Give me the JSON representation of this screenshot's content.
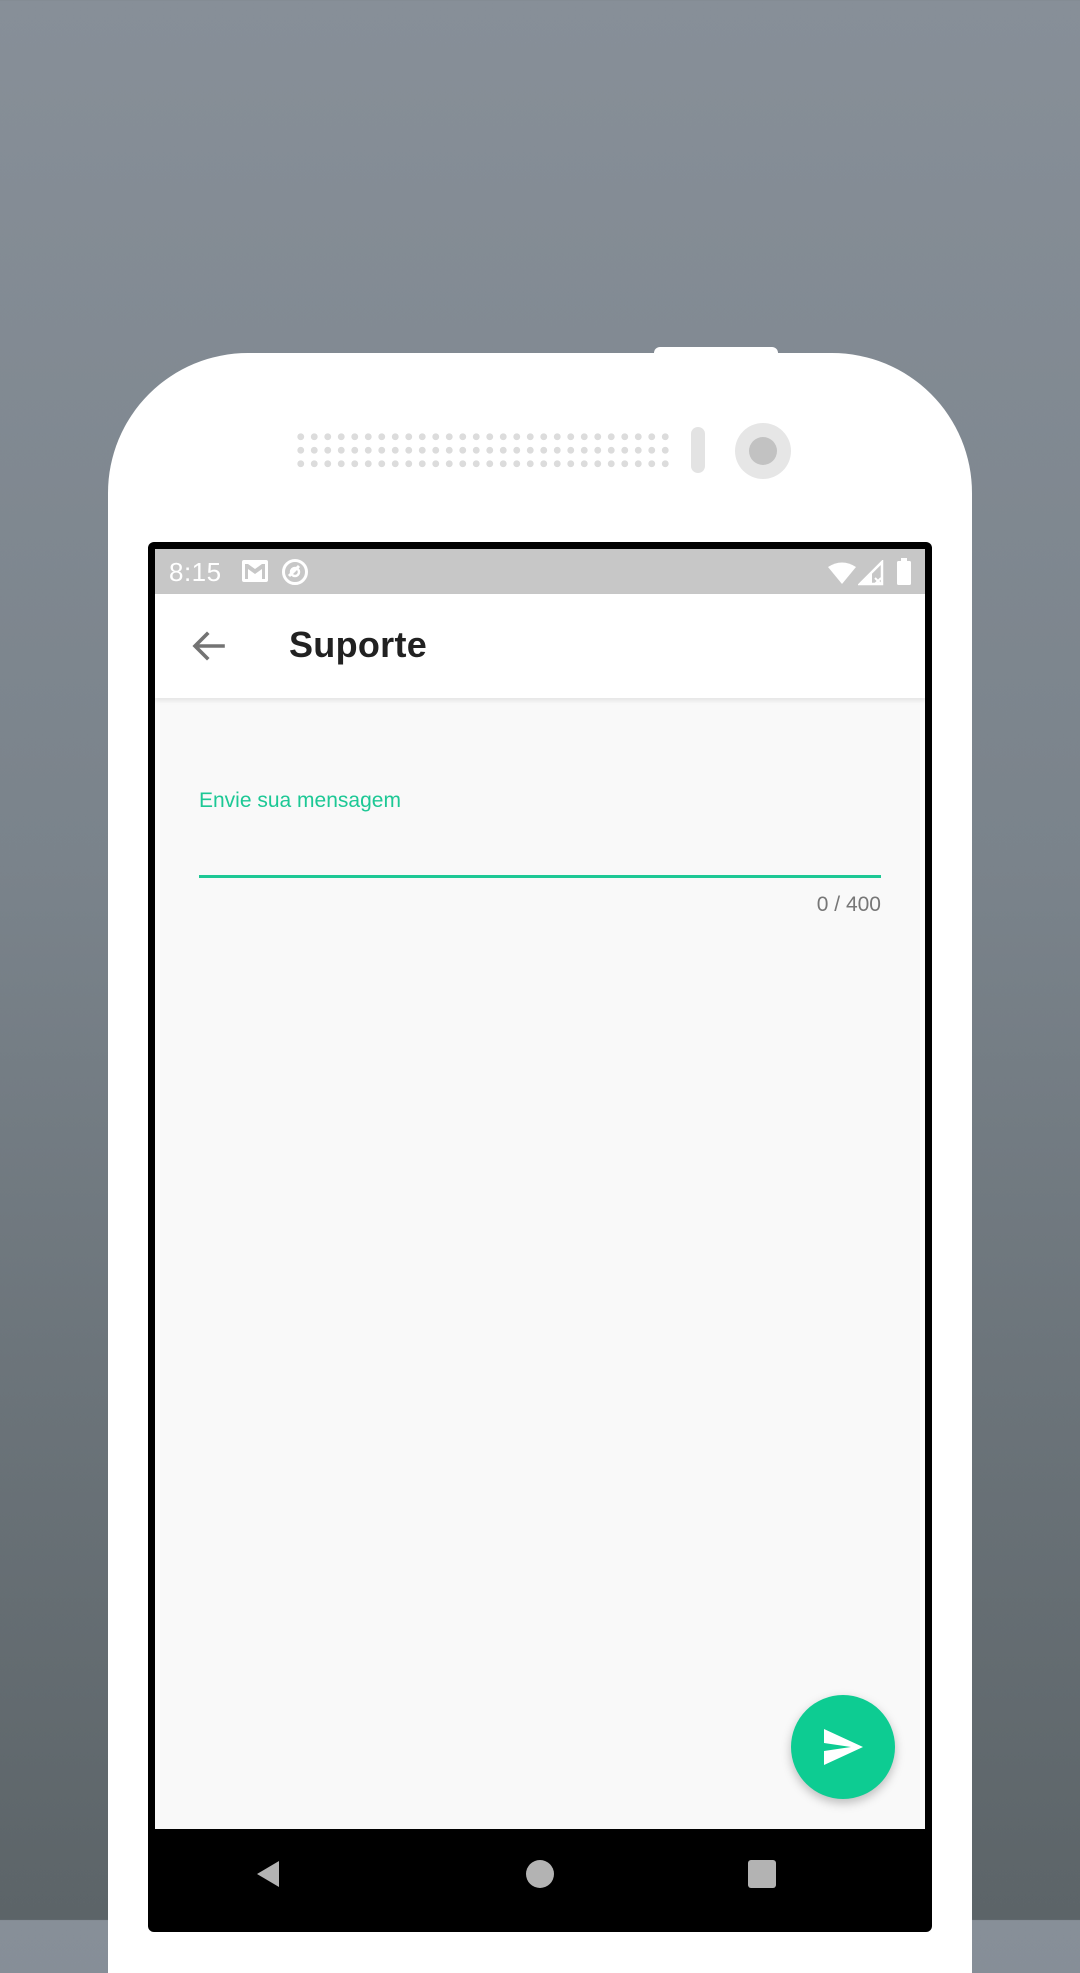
{
  "status_bar": {
    "time": "8:15",
    "icons_left": [
      "gmail-icon",
      "sync-icon"
    ],
    "icons_right": [
      "wifi-icon",
      "signal-icon",
      "battery-icon"
    ]
  },
  "app_bar": {
    "title": "Suporte",
    "back_icon": "arrow-back-icon"
  },
  "message_field": {
    "label": "Envie sua mensagem",
    "value": "",
    "counter": "0 / 400"
  },
  "fab": {
    "icon": "send-icon"
  },
  "nav_bar": {
    "buttons": [
      "back-triangle-icon",
      "home-circle-icon",
      "recents-square-icon"
    ]
  },
  "colors": {
    "accent": "#1dc895",
    "fab": "#0dcc92",
    "status_bar": "#c7c7c7",
    "title_text": "#212121"
  }
}
